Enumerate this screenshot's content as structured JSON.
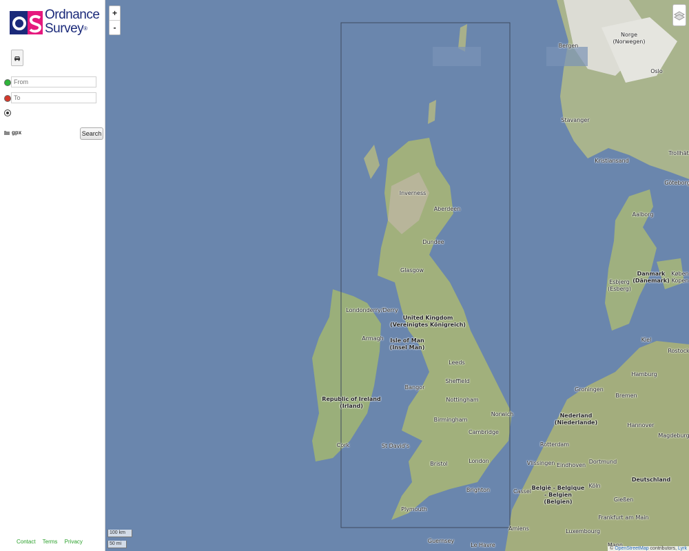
{
  "sidebar": {
    "logo": {
      "line1": "Ordnance",
      "line2": "Survey",
      "mark": "®"
    },
    "car_icon": "car-icon",
    "from_placeholder": "From",
    "to_placeholder": "To",
    "gpx_label": "gpx",
    "search_label": "Search",
    "footer": {
      "contact": "Contact",
      "terms": "Terms",
      "privacy": "Privacy"
    }
  },
  "map": {
    "zoom_in": "+",
    "zoom_out": "-",
    "scale_km": "100 km",
    "scale_mi": "50 mi",
    "attribution": {
      "prefix": "©",
      "osm": "OpenStreetMap",
      "middle": " contributors, ",
      "last": "Lyrk"
    },
    "places": {
      "norge": "Norge\n(Norwegen)",
      "bergen": "Bergen",
      "oslo": "Oslo",
      "stavanger": "Stavanger",
      "kristiansand": "Kristiansand",
      "trollhattan": "Trollhät",
      "goteborg": "Göteborg",
      "aalborg": "Aalborg",
      "danmark": "Danmark\n(Dänemark)",
      "esbjerg": "Esbjerg\n(Esberg)",
      "kobenhavn": "Køben\nKopen",
      "kiel": "Kiel",
      "rostock": "Rostock",
      "hamburg": "Hamburg",
      "groningen": "Groningen",
      "bremen": "Bremen",
      "nederland": "Nederland\n(Niederlande)",
      "hannover": "Hannover",
      "magdeburg": "Magdeburg",
      "rotterdam": "Rotterdam",
      "dortmund": "Dortmund",
      "vlissingen": "Vlissingen",
      "eindhoven": "Eindhoven",
      "deutschland": "Deutschland",
      "belgie": "België - Belgique\n- Belgien\n(Belgien)",
      "koln": "Köln",
      "giessen": "Gießen",
      "calais": "Cassel",
      "frankfurt": "Frankfurt am Main",
      "amiens": "Amiens",
      "luxembourg": "Luxembourg",
      "mannheim": "Mann",
      "inverness": "Inverness",
      "aberdeen": "Aberdeen",
      "dundee": "Dundee",
      "glasgow": "Glasgow",
      "londonderry": "Londonderry/Derry",
      "armagh": "Armagh",
      "uk": "United Kingdom\n(Vereinigtes Königreich)",
      "isleofman": "Isle of Man\n(Insel Man)",
      "leeds": "Leeds",
      "sheffield": "Sheffield",
      "bangor": "Bangor",
      "nottingham": "Nottingham",
      "ireland": "Republic of Ireland\n(Irland)",
      "norwich": "Norwich",
      "birmingham": "Birmingham",
      "cambridge": "Cambridge",
      "cork": "Cork",
      "stdavids": "St David's",
      "bristol": "Bristol",
      "london": "London",
      "brighton": "Brighton",
      "plymouth": "Plymouth",
      "guernsey": "Guernsey",
      "lehavre": "Le Havre"
    }
  }
}
